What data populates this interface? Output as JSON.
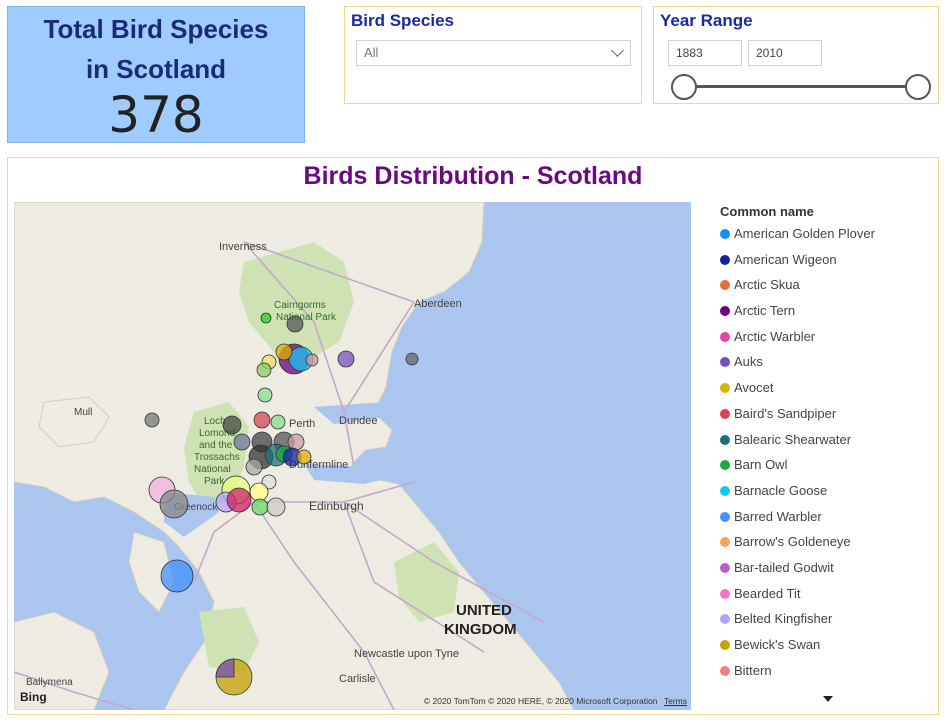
{
  "total_card": {
    "title_line1": "Total Bird Species",
    "title_line2": "in Scotland",
    "value": "378"
  },
  "species_slicer": {
    "header": "Bird Species",
    "selected": "All"
  },
  "year_slicer": {
    "header": "Year Range",
    "start": "1883",
    "end": "2010"
  },
  "map_visual": {
    "title": "Birds Distribution - Scotland",
    "labels": {
      "inverness": "Inverness",
      "aberdeen": "Aberdeen",
      "cairngorms": "Cairngorms\nNational Park",
      "dundee": "Dundee",
      "perth": "Perth",
      "mull": "Mull",
      "loch": "Loch\nLomond\nand the\nTrossachs\nNational\nPark",
      "dunfermline": "Dunfermline",
      "edinburgh": "Edinburgh",
      "greenock": "Greenock",
      "uk": "UNITED\nKINGDOM",
      "newcastle": "Newcastle upon Tyne",
      "carlisle": "Carlisle",
      "ballymena": "Ballymena"
    },
    "bing": "Bing",
    "copyright": "© 2020 TomTom © 2020 HERE, © 2020 Microsoft Corporation",
    "terms": "Terms"
  },
  "legend": {
    "title": "Common name",
    "items": [
      {
        "label": "American Golden Plover",
        "color": "#118dff"
      },
      {
        "label": "American Wigeon",
        "color": "#12239e"
      },
      {
        "label": "Arctic Skua",
        "color": "#e66c37"
      },
      {
        "label": "Arctic Tern",
        "color": "#6b007b"
      },
      {
        "label": "Arctic Warbler",
        "color": "#e044a7"
      },
      {
        "label": "Auks",
        "color": "#744ec2"
      },
      {
        "label": "Avocet",
        "color": "#d9b300"
      },
      {
        "label": "Baird's Sandpiper",
        "color": "#d64550"
      },
      {
        "label": "Balearic Shearwater",
        "color": "#197278"
      },
      {
        "label": "Barn Owl",
        "color": "#1aab40"
      },
      {
        "label": "Barnacle Goose",
        "color": "#15c6f4"
      },
      {
        "label": "Barred Warbler",
        "color": "#4092ff"
      },
      {
        "label": "Barrow's Goldeneye",
        "color": "#ffa058"
      },
      {
        "label": "Bar-tailed Godwit",
        "color": "#be5dc9"
      },
      {
        "label": "Bearded Tit",
        "color": "#f472d0"
      },
      {
        "label": "Belted Kingfisher",
        "color": "#b5a1ff"
      },
      {
        "label": "Bewick's Swan",
        "color": "#c4a200"
      },
      {
        "label": "Bittern",
        "color": "#f08080"
      }
    ]
  }
}
